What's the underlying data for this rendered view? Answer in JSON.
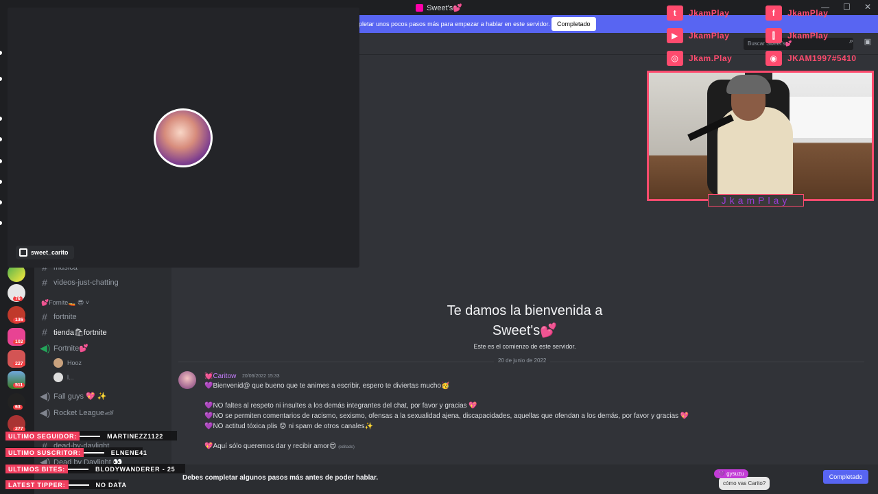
{
  "window": {
    "title": "Sweet's💕",
    "controls": [
      "—",
      "☐",
      "✕"
    ]
  },
  "notice": {
    "text": "pletar unos pocos pasos más para empezar a hablar en este servidor.",
    "button": "Completado"
  },
  "topbar": {
    "search_placeholder": "Buscar Sweet's💕"
  },
  "sidebar": {
    "channels": [
      {
        "label": "música",
        "active": false
      },
      {
        "label": "videos-just-chatting",
        "active": false
      }
    ],
    "category": "💕Fornite🚤 😎 ˅",
    "fortnite_channels": [
      {
        "label": "fortnite",
        "active": false
      },
      {
        "label": "tienda🛍fortnite",
        "active": true
      }
    ],
    "voice_channel": "Fortnite💕",
    "voice_users": [
      "Hooz",
      "l..."
    ],
    "more_channels": [
      {
        "label": "Fall guys 💖 ✨"
      },
      {
        "label": "Rocket League🏎"
      },
      {
        "label": "dead-by-daylight"
      },
      {
        "label": "Dead by Daylight 👀"
      }
    ]
  },
  "server_badges": [
    "76",
    "136",
    "102",
    "227",
    "511",
    "63",
    "277"
  ],
  "welcome": {
    "line1": "Te damos la bienvenida a",
    "line2": "Sweet's💕",
    "subtitle": "Este es el comienzo de este servidor.",
    "date_divider": "20 de junio de 2022"
  },
  "message": {
    "author": "💓Caritow",
    "timestamp": "20/06/2022 15:33",
    "lines": [
      "💜Bienvenid@ que bueno que te animes a escribir, espero te diviertas mucho🥳",
      "💜NO faltes al respeto ni insultes a los demás integrantes del chat, por favor y gracias 💖",
      "💜NO se permiten comentarios de racismo, sexismo, ofensas a la sexualidad ajena, discapacidades, aquellas que ofendan a los demás, por favor y gracias 💖",
      "💜NO actitud tóxica plis 😟 ni spam de otros canales✨",
      "💖Aquí sólo queremos dar y recibir amor😍"
    ],
    "edited": "(editado)"
  },
  "composer": {
    "text": "Debes completar algunos pasos más antes de poder hablar.",
    "button": "Completado"
  },
  "popup": {
    "streamer": "sweet_carito"
  },
  "social": [
    {
      "icon": "twitter-icon",
      "glyph": "t",
      "handle": "JkamPlay"
    },
    {
      "icon": "facebook-icon",
      "glyph": "f",
      "handle": "JkamPlay"
    },
    {
      "icon": "youtube-icon",
      "glyph": "▶",
      "handle": "JkamPlay"
    },
    {
      "icon": "twitch-icon",
      "glyph": "⫿",
      "handle": "JkamPlay"
    },
    {
      "icon": "instagram-icon",
      "glyph": "◎",
      "handle": "Jkam.Play"
    },
    {
      "icon": "discord-icon",
      "glyph": "◉",
      "handle": "JKAM1997#5410"
    }
  ],
  "webcam_label": "JkamPlay",
  "stream_stats": [
    {
      "label": "ULTIMO SEGUIDOR:",
      "value": "MARTINEZZ1122"
    },
    {
      "label": "ULTIMO SUSCRITOR:",
      "value": "ELNENE41"
    },
    {
      "label": "ULTIMOS BITES:",
      "value": "BLODYWANDERER - 25"
    },
    {
      "label": "LATEST TIPPER:",
      "value": "NO DATA"
    }
  ],
  "chat_bubble": {
    "name": "💜 gysuzu",
    "text": "cómo vas Carito?"
  },
  "colors": {
    "accent": "#5865f2",
    "overlay_pink": "#ff4b6e",
    "author": "#c77dff"
  }
}
